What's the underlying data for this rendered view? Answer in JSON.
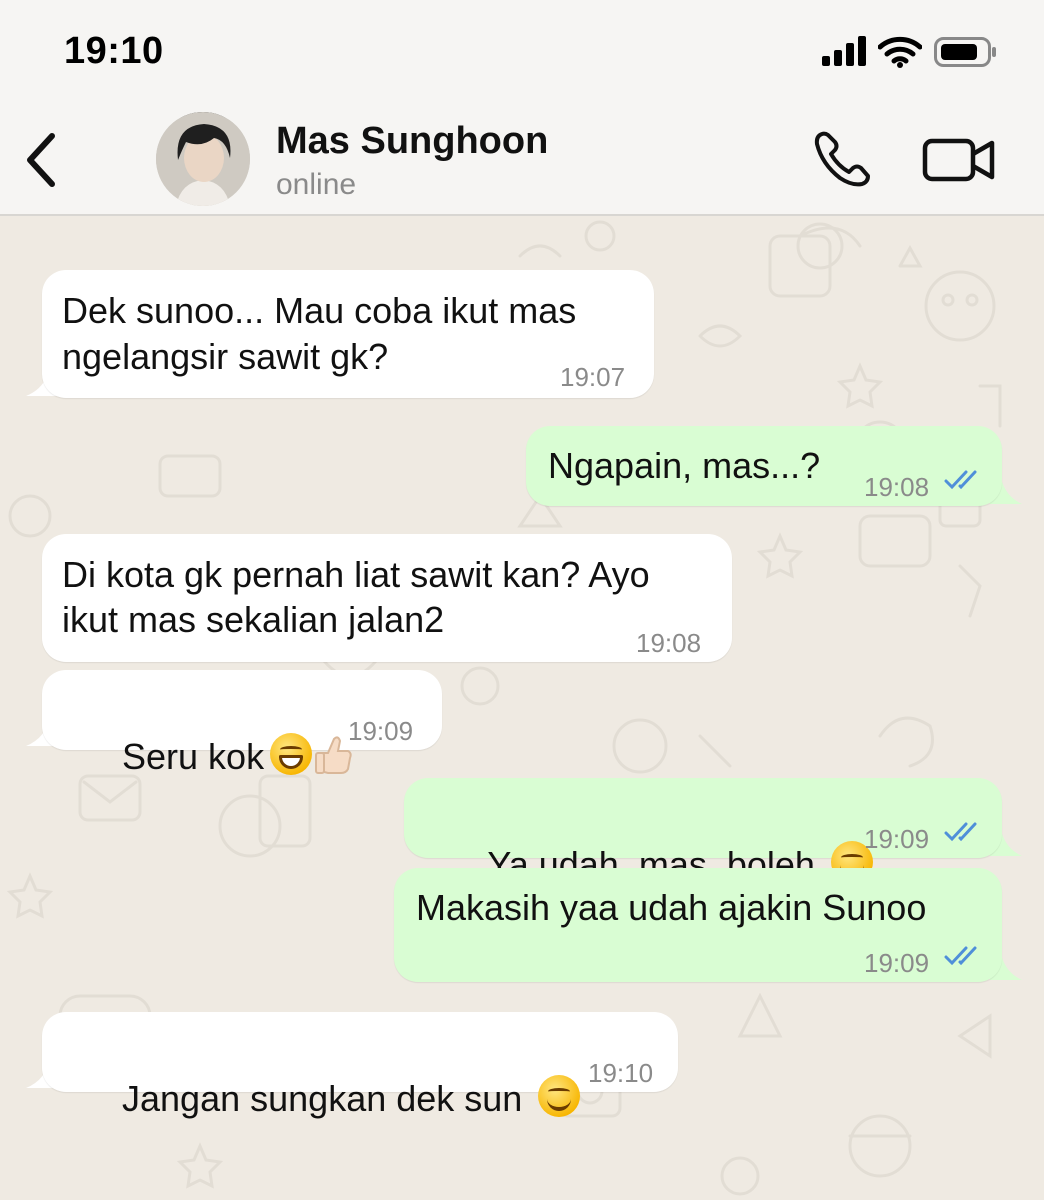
{
  "status_bar": {
    "time": "19:10"
  },
  "header": {
    "contact_name": "Mas Sunghoon",
    "contact_status": "online"
  },
  "colors": {
    "incoming_bubble": "#ffffff",
    "outgoing_bubble": "#d9fdd3",
    "read_ticks": "#4f8fd9",
    "chat_background": "#efeae2"
  },
  "messages": [
    {
      "direction": "incoming",
      "text_lines": [
        "Dek sunoo... Mau coba ikut mas",
        "ngelangsir sawit gk?"
      ],
      "time": "19:07"
    },
    {
      "direction": "outgoing",
      "text_lines": [
        "Ngapain, mas...?"
      ],
      "time": "19:08",
      "status": "read"
    },
    {
      "direction": "incoming",
      "text_lines": [
        "Di kota gk pernah liat sawit kan? Ayo",
        "ikut mas sekalian jalan2"
      ],
      "time": "19:08"
    },
    {
      "direction": "incoming",
      "text_lines": [
        "Seru kok"
      ],
      "emojis": [
        "grinning-face",
        "thumbs-up"
      ],
      "time": "19:09"
    },
    {
      "direction": "outgoing",
      "text_lines": [
        "Ya udah, mas, boleh"
      ],
      "emojis": [
        "smiling-face"
      ],
      "time": "19:09",
      "status": "read"
    },
    {
      "direction": "outgoing",
      "text_lines": [
        "Makasih yaa udah ajakin Sunoo"
      ],
      "time": "19:09",
      "status": "read"
    },
    {
      "direction": "incoming",
      "text_lines": [
        "Jangan sungkan dek sun"
      ],
      "emojis": [
        "smiling-face"
      ],
      "time": "19:10"
    }
  ]
}
